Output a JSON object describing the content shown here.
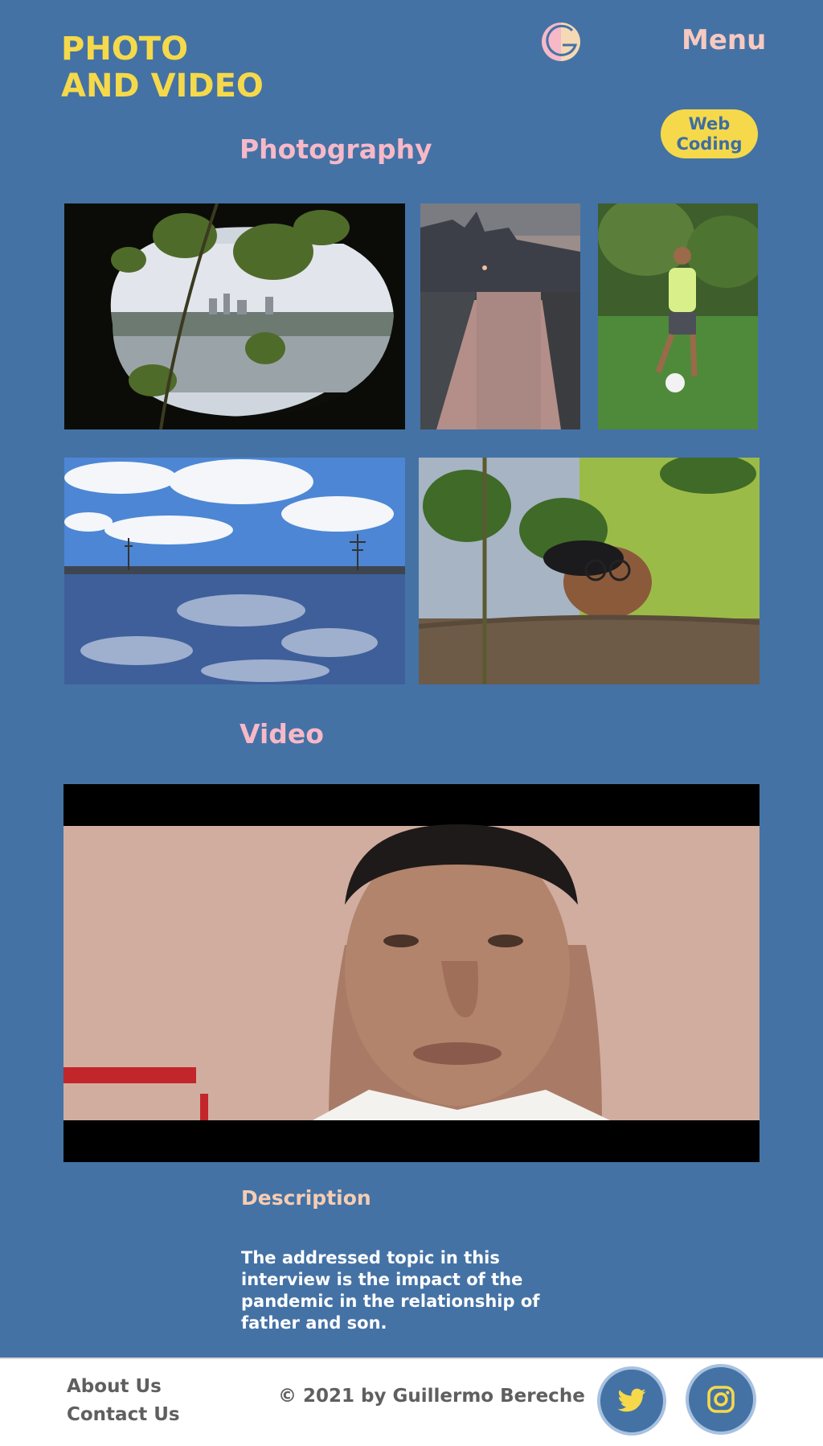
{
  "header": {
    "title_line1": "PHOTO",
    "title_line2": "AND VIDEO",
    "menu_label": "Menu",
    "pill_line1": "Web",
    "pill_line2": "Coding"
  },
  "sections": {
    "photography_title": "Photography",
    "video_title": "Video"
  },
  "description": {
    "title": "Description",
    "text": "The addressed topic in this interview is the impact of the pandemic in the relationship of father and son."
  },
  "footer": {
    "about": "About Us",
    "contact": "Contact Us",
    "copyright": "© 2021 by Guillermo Bereche"
  },
  "colors": {
    "background": "#4472a5",
    "accent_yellow": "#f5d94a",
    "accent_pink": "#f7b8c8",
    "footer_text": "#5f5f5f"
  },
  "icons": [
    "logo-icon",
    "twitter-icon",
    "instagram-icon"
  ]
}
